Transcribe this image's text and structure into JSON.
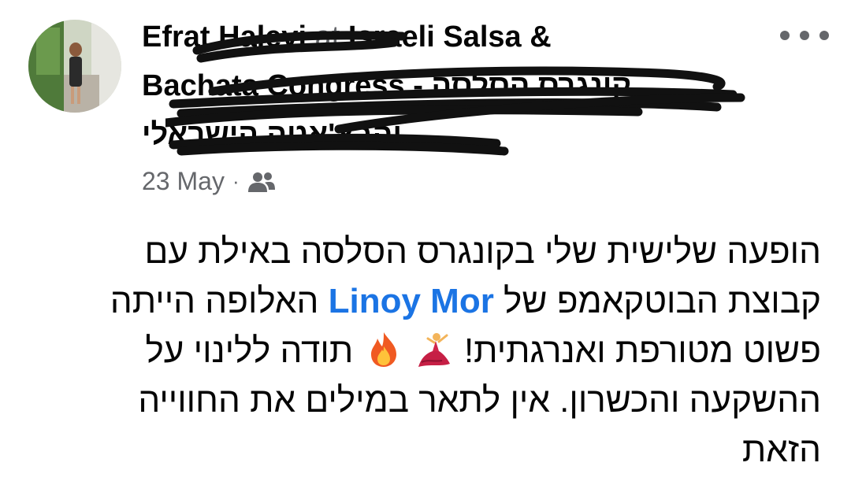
{
  "post": {
    "author_name": "Efrat Halevi",
    "at_label": "at",
    "place_name": "Israeli Salsa &",
    "place_line2": "Bachata Congress - קונגרס הסלסה",
    "place_line3": "והבצ'אטה הישראלי",
    "date": "23 May",
    "separator": "·",
    "audience_icon": "friends-icon",
    "more_icon": "more-options-icon"
  },
  "body": {
    "text_before_mention": "הופעה שלישית שלי בקונגרס הסלסה באילת עם קבוצת הבוטקאמפ של ",
    "mention": "Linoy Mor",
    "text_after_mention": " האלופה הייתה פשוט מטורפת ואנרגתית! ",
    "emoji_1": "flamenco-dancer-emoji",
    "emoji_2": "fire-emoji",
    "text_end": " תודה ללינוי  על ההשקעה והכשרון. אין לתאר במילים את החווייה הזאת"
  },
  "colors": {
    "mention": "#1b74e4",
    "meta_text": "#65676b",
    "text": "#050505"
  }
}
